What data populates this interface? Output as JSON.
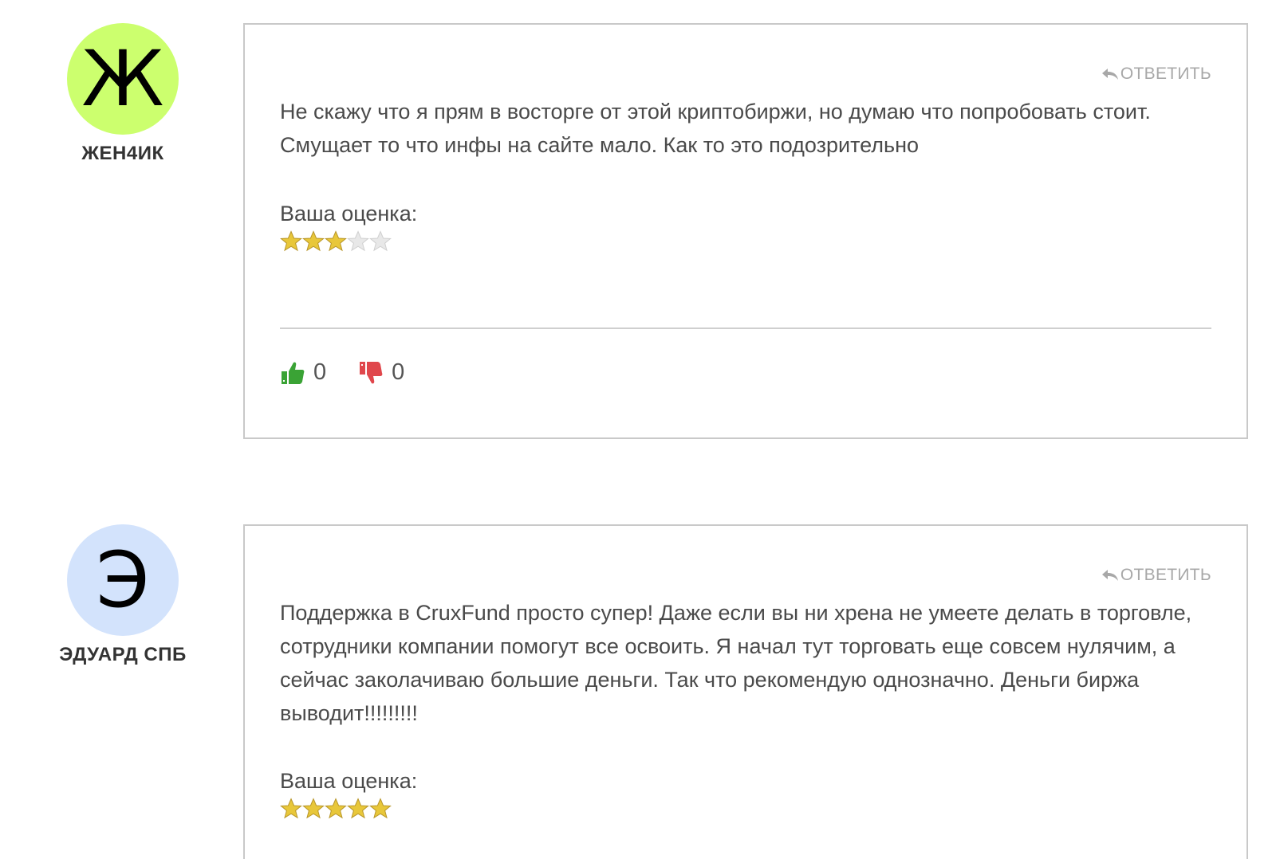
{
  "comments": [
    {
      "author": {
        "initial": "Ж",
        "name": "ЖЕН4ИК",
        "avatar_color": "#ccff6e"
      },
      "reply_label": "ОТВЕТИТЬ",
      "text": "Не скажу что я прям в восторге от этой криптобиржи, но думаю что попробовать стоит. Смущает то что инфы на сайте мало. Как то это подозрительно",
      "rating_label": "Ваша оценка:",
      "rating": 3,
      "rating_max": 5,
      "likes": "0",
      "dislikes": "0"
    },
    {
      "author": {
        "initial": "Э",
        "name": "ЭДУАРД СПБ",
        "avatar_color": "#d3e3fc"
      },
      "reply_label": "ОТВЕТИТЬ",
      "text": "Поддержка в CruxFund просто супер! Даже если вы ни хрена не умеете делать в торговле, сотрудники компании помогут все освоить. Я начал тут торговать еще совсем нулячим, а сейчас заколачиваю большие деньги. Так что рекомендую однозначно. Деньги биржа выводит!!!!!!!!!",
      "rating_label": "Ваша оценка:",
      "rating": 5,
      "rating_max": 5
    }
  ],
  "colors": {
    "star_filled": "#e8c73a",
    "star_empty": "#e8e8e8",
    "like": "#3aa335",
    "dislike": "#e0474c",
    "reply": "#a8a8a8",
    "border": "#c9c9c9"
  },
  "icons": {
    "reply": "reply-arrow-icon",
    "like": "thumbs-up-icon",
    "dislike": "thumbs-down-icon",
    "star": "star-icon"
  }
}
